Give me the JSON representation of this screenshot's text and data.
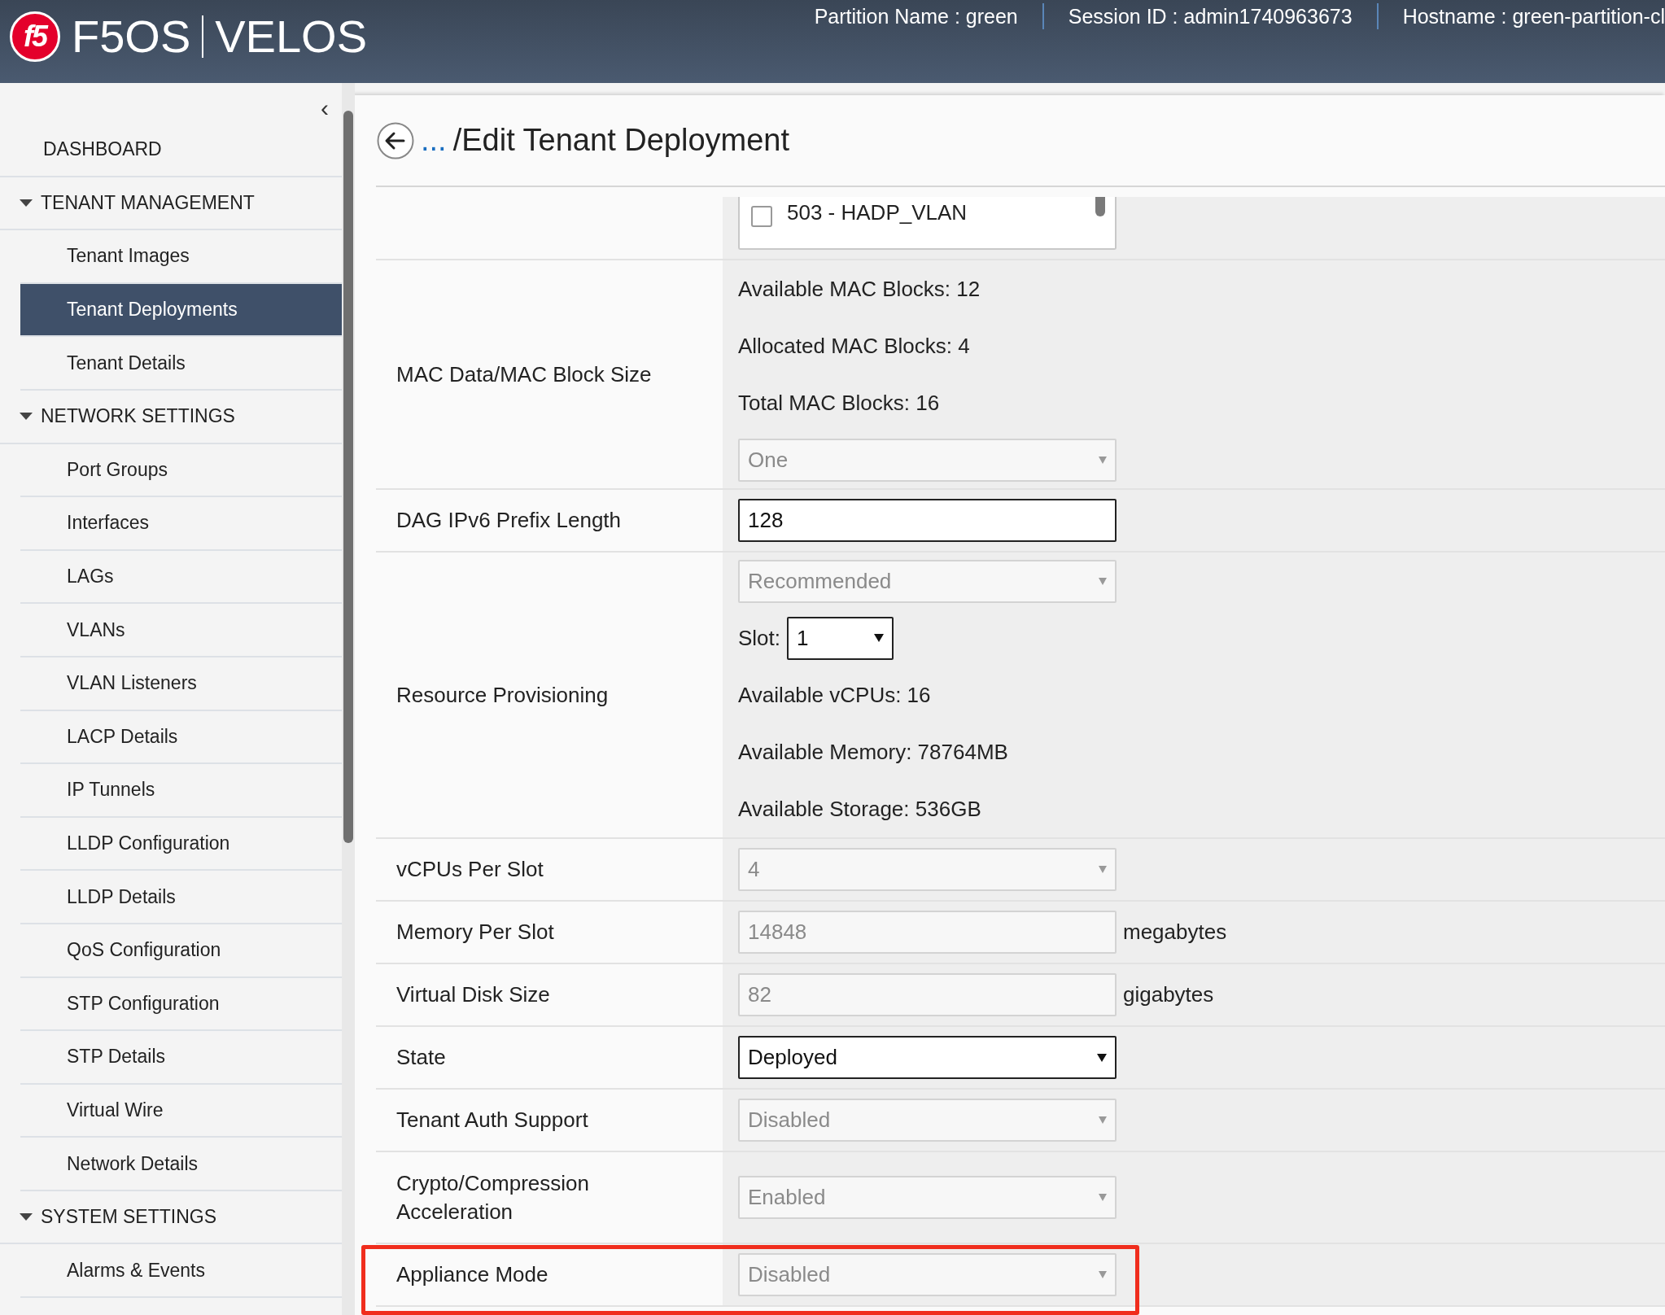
{
  "header": {
    "logo_mark": "f5",
    "product": "F5OS",
    "name": "VELOS",
    "info": [
      "Partition Name : green",
      "Session ID : admin1740963673",
      "Hostname : green-partition-cl"
    ]
  },
  "sidebar": {
    "collapse_icon": "‹",
    "items": [
      {
        "label": "DASHBOARD",
        "kind": "link"
      },
      {
        "label": "TENANT MANAGEMENT",
        "kind": "section",
        "expanded": true,
        "children": [
          {
            "label": "Tenant Images",
            "selected": false
          },
          {
            "label": "Tenant Deployments",
            "selected": true
          },
          {
            "label": "Tenant Details",
            "selected": false
          }
        ]
      },
      {
        "label": "NETWORK SETTINGS",
        "kind": "section",
        "expanded": true,
        "children": [
          {
            "label": "Port Groups",
            "selected": false
          },
          {
            "label": "Interfaces",
            "selected": false
          },
          {
            "label": "LAGs",
            "selected": false
          },
          {
            "label": "VLANs",
            "selected": false
          },
          {
            "label": "VLAN Listeners",
            "selected": false
          },
          {
            "label": "LACP Details",
            "selected": false
          },
          {
            "label": "IP Tunnels",
            "selected": false
          },
          {
            "label": "LLDP Configuration",
            "selected": false
          },
          {
            "label": "LLDP Details",
            "selected": false
          },
          {
            "label": "QoS Configuration",
            "selected": false
          },
          {
            "label": "STP Configuration",
            "selected": false
          },
          {
            "label": "STP Details",
            "selected": false
          },
          {
            "label": "Virtual Wire",
            "selected": false
          },
          {
            "label": "Network Details",
            "selected": false
          }
        ]
      },
      {
        "label": "SYSTEM SETTINGS",
        "kind": "section",
        "expanded": true,
        "children": [
          {
            "label": "Alarms & Events",
            "selected": false
          }
        ]
      }
    ]
  },
  "page": {
    "breadcrumb_link": "...",
    "title": "/Edit Tenant Deployment"
  },
  "form": {
    "rows": [
      {
        "label": "",
        "highlighted": false,
        "controls": [
          {
            "kind": "checklist",
            "items": [
              {
                "label": "503 - HADP_VLAN",
                "checked": false
              }
            ]
          }
        ]
      },
      {
        "label": "MAC Data/MAC Block Size",
        "highlighted": false,
        "controls": [
          {
            "kind": "text",
            "text": "Available MAC Blocks: 12"
          },
          {
            "kind": "text",
            "text": "Allocated MAC Blocks: 4"
          },
          {
            "kind": "text",
            "text": "Total MAC Blocks: 16"
          },
          {
            "kind": "select",
            "value": "One",
            "disabled": true
          }
        ]
      },
      {
        "label": "DAG IPv6 Prefix Length",
        "highlighted": false,
        "controls": [
          {
            "kind": "input",
            "value": "128",
            "disabled": false
          }
        ]
      },
      {
        "label": "Resource Provisioning",
        "highlighted": false,
        "controls": [
          {
            "kind": "select",
            "value": "Recommended",
            "disabled": true
          },
          {
            "kind": "slot",
            "label": "Slot:",
            "value": "1"
          },
          {
            "kind": "text",
            "text": "Available vCPUs: 16"
          },
          {
            "kind": "text",
            "text": "Available Memory: 78764MB"
          },
          {
            "kind": "text",
            "text": "Available Storage: 536GB"
          }
        ]
      },
      {
        "label": "vCPUs Per Slot",
        "highlighted": false,
        "controls": [
          {
            "kind": "select",
            "value": "4",
            "disabled": true
          }
        ]
      },
      {
        "label": "Memory Per Slot",
        "highlighted": false,
        "controls": [
          {
            "kind": "input",
            "value": "14848",
            "disabled": true,
            "unit": "megabytes"
          }
        ]
      },
      {
        "label": "Virtual Disk Size",
        "highlighted": false,
        "controls": [
          {
            "kind": "input",
            "value": "82",
            "disabled": true,
            "unit": "gigabytes"
          }
        ]
      },
      {
        "label": "State",
        "highlighted": false,
        "controls": [
          {
            "kind": "select",
            "value": "Deployed",
            "disabled": false
          }
        ]
      },
      {
        "label": "Tenant Auth Support",
        "highlighted": false,
        "controls": [
          {
            "kind": "select",
            "value": "Disabled",
            "disabled": true
          }
        ]
      },
      {
        "label": "Crypto/Compression Acceleration",
        "highlighted": false,
        "controls": [
          {
            "kind": "select",
            "value": "Enabled",
            "disabled": true
          }
        ]
      },
      {
        "label": "Appliance Mode",
        "highlighted": true,
        "controls": [
          {
            "kind": "select",
            "value": "Disabled",
            "disabled": true
          }
        ]
      }
    ]
  }
}
